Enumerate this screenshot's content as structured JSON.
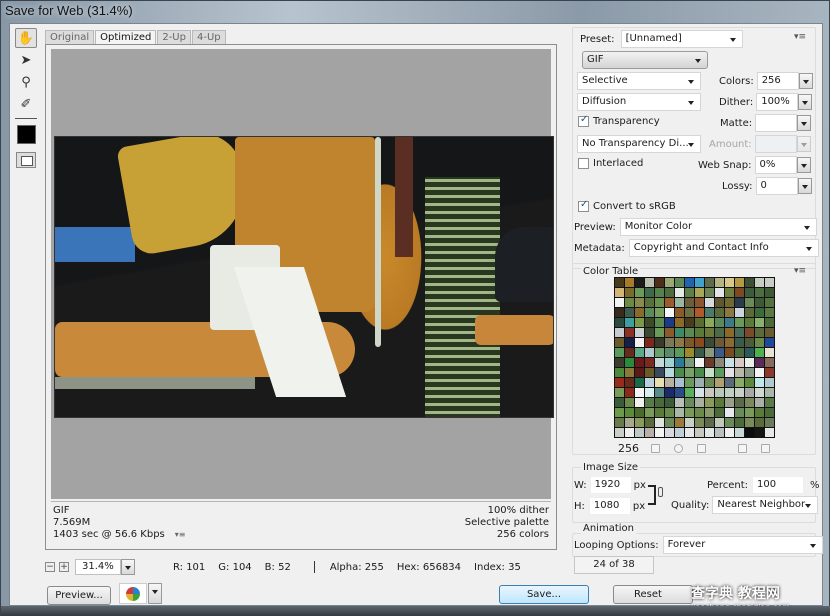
{
  "window": {
    "title": "Save for Web (31.4%)"
  },
  "tools": [
    {
      "name": "hand-tool-icon",
      "glyph": "✋",
      "active": true
    },
    {
      "name": "slice-select-tool-icon",
      "glyph": "➤",
      "active": false
    },
    {
      "name": "zoom-tool-icon",
      "glyph": "⚲",
      "active": false
    },
    {
      "name": "eyedropper-tool-icon",
      "glyph": "✐",
      "active": false
    }
  ],
  "tabs": [
    {
      "label": "Original",
      "selected": false
    },
    {
      "label": "Optimized",
      "selected": true
    },
    {
      "label": "2-Up",
      "selected": false
    },
    {
      "label": "4-Up",
      "selected": false
    }
  ],
  "optimized_info": {
    "format": "GIF",
    "size": "7.569M",
    "download_time": "1403 sec @ 56.6 Kbps",
    "dither": "100% dither",
    "palette": "Selective palette",
    "colors": "256 colors"
  },
  "status": {
    "zoom": "31.4%",
    "r": "R: 101",
    "g": "G: 104",
    "b": "B: 52",
    "alpha": "Alpha: 255",
    "hex": "Hex: 656834",
    "index": "Index: 35"
  },
  "buttons": {
    "preview": "Preview...",
    "save": "Save...",
    "reset": "Reset"
  },
  "settings": {
    "preset_label": "Preset:",
    "preset_value": "[Unnamed]",
    "format": "GIF",
    "reduction": "Selective",
    "colors_label": "Colors:",
    "colors_value": "256",
    "dither_algorithm": "Diffusion",
    "dither_label": "Dither:",
    "dither_value": "100%",
    "transparency_label": "Transparency",
    "transparency_checked": true,
    "matte_label": "Matte:",
    "matte_value": "",
    "transparency_dither": "No Transparency Di...",
    "amount_label": "Amount:",
    "interlaced_label": "Interlaced",
    "interlaced_checked": false,
    "web_snap_label": "Web Snap:",
    "web_snap_value": "0%",
    "lossy_label": "Lossy:",
    "lossy_value": "0",
    "convert_srgb_label": "Convert to sRGB",
    "convert_srgb_checked": true,
    "preview_label": "Preview:",
    "preview_value": "Monitor Color",
    "metadata_label": "Metadata:",
    "metadata_value": "Copyright and Contact Info"
  },
  "color_table": {
    "title": "Color Table",
    "count": "256",
    "palette": [
      "#4a3a1c",
      "#a77a2c",
      "#1d1c18",
      "#b9c0ae",
      "#4d2d1a",
      "#9aa874",
      "#5f8a57",
      "#1f64b0",
      "#3fa1cc",
      "#5b6b4c",
      "#b3b684",
      "#d7c98a",
      "#b49a45",
      "#3d4f33",
      "#c6ccc0",
      "#c9cdc8",
      "#d2b678",
      "#7c6a2a",
      "#6b9a5a",
      "#3e6a4b",
      "#57814c",
      "#4c6b3f",
      "#e5ece5",
      "#5f7f48",
      "#a8a657",
      "#6d8456",
      "#e3e7ea",
      "#6f7f3e",
      "#7c4a22",
      "#3a5b3c",
      "#4e6d41",
      "#3c5a33",
      "#f3f5f4",
      "#6d8a45",
      "#8a8a4c",
      "#58713c",
      "#6b9050",
      "#9a5c2c",
      "#9bb6a0",
      "#6a5d3a",
      "#8a5630",
      "#d5dbe0",
      "#5f5530",
      "#6f6a32",
      "#2a3b4e",
      "#6a8a5a",
      "#3d5a35",
      "#56733e",
      "#3a2a1e",
      "#3d5a4c",
      "#8a6a2a",
      "#5c8a5c",
      "#7aa060",
      "#f5f7f6",
      "#8a5a28",
      "#6e6e40",
      "#b05a2c",
      "#4c7a6a",
      "#5a6a3a",
      "#8a7a40",
      "#cdd6e0",
      "#5c6a3a",
      "#3c6a3c",
      "#5a7a44",
      "#2a4a3e",
      "#3ca0a0",
      "#7a9a4a",
      "#3c4a2a",
      "#5a8a50",
      "#1a3a8a",
      "#8a6a24",
      "#4a3a1e",
      "#5a6a30",
      "#8aaa5a",
      "#5a8a5a",
      "#3a7a8a",
      "#6a9a5a",
      "#5a7a3a",
      "#8ab070",
      "#4a6a3a",
      "#c8cbd0",
      "#8a3024",
      "#cad0d4",
      "#3a4a30",
      "#6a9a5a",
      "#8a5a2a",
      "#3c8a6a",
      "#5a8a50",
      "#5a7a3a",
      "#6a7a3a",
      "#4a6a4a",
      "#8a6a2a",
      "#4a6a5a",
      "#7a4a2a",
      "#5a6a3a",
      "#6a5a30",
      "#6a5a2a",
      "#14204a",
      "#f2f2f4",
      "#7a2a1a",
      "#3a3a2a",
      "#7a7a5a",
      "#8a7a4a",
      "#7a5a2a",
      "#8a4a20",
      "#3a4a3a",
      "#6a5a3a",
      "#8a6a30",
      "#3a5a4a",
      "#4a5a3a",
      "#6a8a4a",
      "#1e4a9a",
      "#5a9a5a",
      "#6a2a1a",
      "#5aaa8a",
      "#aec8d0",
      "#6aa06a",
      "#5a8a6a",
      "#5a9a5a",
      "#9a8a2a",
      "#3a5a4a",
      "#8a9a7a",
      "#3a5a8a",
      "#7a4a20",
      "#4a6a3a",
      "#2a5a5a",
      "#50b050",
      "#e8e4d0",
      "#3c3c2e",
      "#2a8a3a",
      "#6a1a1a",
      "#7a2a1e",
      "#c8d8d8",
      "#a0d0d0",
      "#2a7a9a",
      "#7a9a7a",
      "#f4f4f4",
      "#6a3a2a",
      "#8a8a7a",
      "#c8e0e8",
      "#d8c8c8",
      "#e8f0e8",
      "#5a2a5a",
      "#8a6a5a",
      "#4a8a3a",
      "#8a7a3a",
      "#5a1a1a",
      "#6a5a2a",
      "#3a4a5a",
      "#b8d8e0",
      "#4a8a4a",
      "#7aa06a",
      "#4a8a4a",
      "#c8e0c8",
      "#5a9a5a",
      "#e8e0e8",
      "#b8b8a8",
      "#8a9a8a",
      "#f4f4f4",
      "#8a3a2a",
      "#9a2a1a",
      "#6a2a1a",
      "#1a6a4a",
      "#b8d0e0",
      "#e8e0b0",
      "#b8b0a0",
      "#a8c0d0",
      "#6a9a5a",
      "#9ab0b0",
      "#6a8a5a",
      "#b0a070",
      "#5a6a7a",
      "#8aaa6a",
      "#5a8a3a",
      "#c0e8e8",
      "#b0c8d0",
      "#7a9a5a",
      "#8a2a1a",
      "#f4f4f4",
      "#d8f0f0",
      "#5a8a8a",
      "#1a2a6a",
      "#2a4a8a",
      "#5ab05a",
      "#d8e0e8",
      "#c8c8c0",
      "#b8c8b8",
      "#c0d0c0",
      "#c8d0c8",
      "#a8a8a8",
      "#d0d8d0",
      "#a8b8a8",
      "#3a5a3a",
      "#6a8a4a",
      "#f0f2f0",
      "#5a7a4a",
      "#4a6a3a",
      "#3a5a3a",
      "#b8c0b8",
      "#6a8a5a",
      "#a8b0a0",
      "#8a9a5a",
      "#5a7a3a",
      "#9aa08a",
      "#5a6a4a",
      "#7a8a5a",
      "#a8b0a8",
      "#5a7a4a",
      "#6a9a4a",
      "#5a8a3a",
      "#4a6a2a",
      "#7a9a5a",
      "#5a7a3a",
      "#6a8a4a",
      "#a8b8a8",
      "#7a9a5a",
      "#6a8a4a",
      "#8a9a6a",
      "#4a6a3a",
      "#e8e8f0",
      "#6a8a5a",
      "#7a9a5a",
      "#5a7a3a",
      "#4a6a3a",
      "#6a7a4a",
      "#a8a890",
      "#8a9a5a",
      "#5a6a3a",
      "#e0e4e0",
      "#6a8a5a",
      "#9a7a3a",
      "#c8d0c8",
      "#7a8a5a",
      "#5a6a4a",
      "#c0c8b8",
      "#6a8a5a",
      "#4a6a3a",
      "#7a8a5a",
      "#5a6a3a",
      "#6a7a5a",
      "#c8d0c8",
      "#f0f0f0",
      "#c0c8c8",
      "#b8b0a8",
      "#f4f4f4",
      "#d8d8e0",
      "#c0d0d8",
      "#e8e8e8",
      "#c8c8c0",
      "#e0e8e8",
      "#b8c0c0",
      "#f0f0f0",
      "#c8d8d8",
      "#0c0c0c",
      "#141414",
      "#e8e8e8"
    ]
  },
  "image_size": {
    "title": "Image Size",
    "w_label": "W:",
    "w_value": "1920",
    "h_label": "H:",
    "h_value": "1080",
    "unit": "px",
    "percent_label": "Percent:",
    "percent_value": "100",
    "percent_unit": "%",
    "quality_label": "Quality:",
    "quality_value": "Nearest Neighbor"
  },
  "animation": {
    "title": "Animation",
    "looping_label": "Looping Options:",
    "looping_value": "Forever",
    "frame_counter": "24 of 38"
  },
  "watermark": {
    "line1": "查字典 教程网",
    "line2": "jiaocheng.chazidian.com"
  }
}
